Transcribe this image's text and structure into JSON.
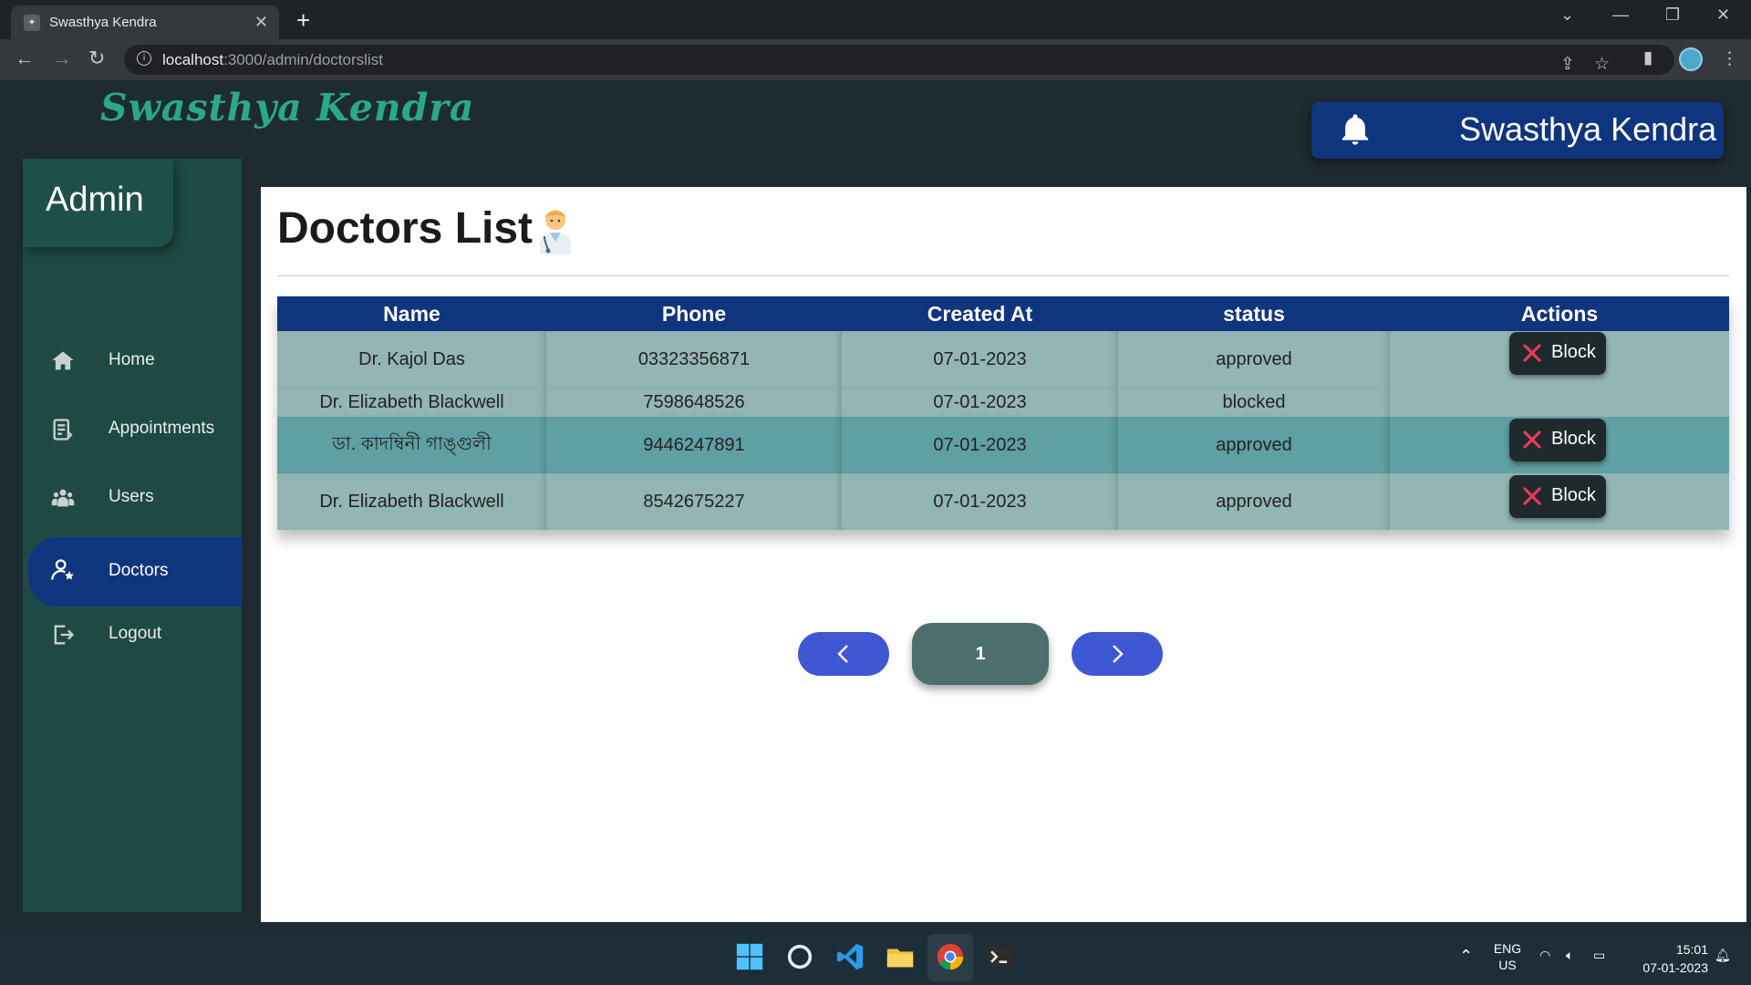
{
  "browser": {
    "tab_title": "Swasthya Kendra",
    "url_host": "localhost",
    "url_path": ":3000/admin/doctorslist"
  },
  "app": {
    "brand": "Swasthya Kendra",
    "header_title": "Swasthya Kendra"
  },
  "sidebar": {
    "title": "Admin",
    "items": [
      {
        "label": "Home",
        "icon": "home-icon"
      },
      {
        "label": "Appointments",
        "icon": "appointments-icon"
      },
      {
        "label": "Users",
        "icon": "users-icon"
      },
      {
        "label": "Doctors",
        "icon": "doctor-icon",
        "active": true
      },
      {
        "label": "Logout",
        "icon": "logout-icon"
      }
    ]
  },
  "main": {
    "page_title": "Doctors List",
    "table": {
      "headers": [
        "Name",
        "Phone",
        "Created At",
        "status",
        "Actions"
      ],
      "rows": [
        {
          "name": "Dr. Kajol Das",
          "phone": "03323356871",
          "created_at": "07-01-2023",
          "status": "approved",
          "action": "Block"
        },
        {
          "name": "Dr. Elizabeth Blackwell",
          "phone": "7598648526",
          "created_at": "07-01-2023",
          "status": "blocked",
          "action": ""
        },
        {
          "name": "ডা. কাদম্বিনী গাঙ্গুলী",
          "phone": "9446247891",
          "created_at": "07-01-2023",
          "status": "approved",
          "action": "Block"
        },
        {
          "name": "Dr. Elizabeth Blackwell",
          "phone": "8542675227",
          "created_at": "07-01-2023",
          "status": "approved",
          "action": "Block"
        }
      ]
    },
    "pagination": {
      "current_page": "1"
    }
  },
  "taskbar": {
    "lang_top": "ENG",
    "lang_bottom": "US",
    "time": "15:01",
    "date": "07-01-2023"
  },
  "colors": {
    "accent": "#10357f",
    "brand_green": "#2aa98a",
    "sidebar": "#1f4a44",
    "row": "#94b5b5",
    "row_highlight": "#5fa0a2",
    "block_x": "#e83a5a"
  }
}
